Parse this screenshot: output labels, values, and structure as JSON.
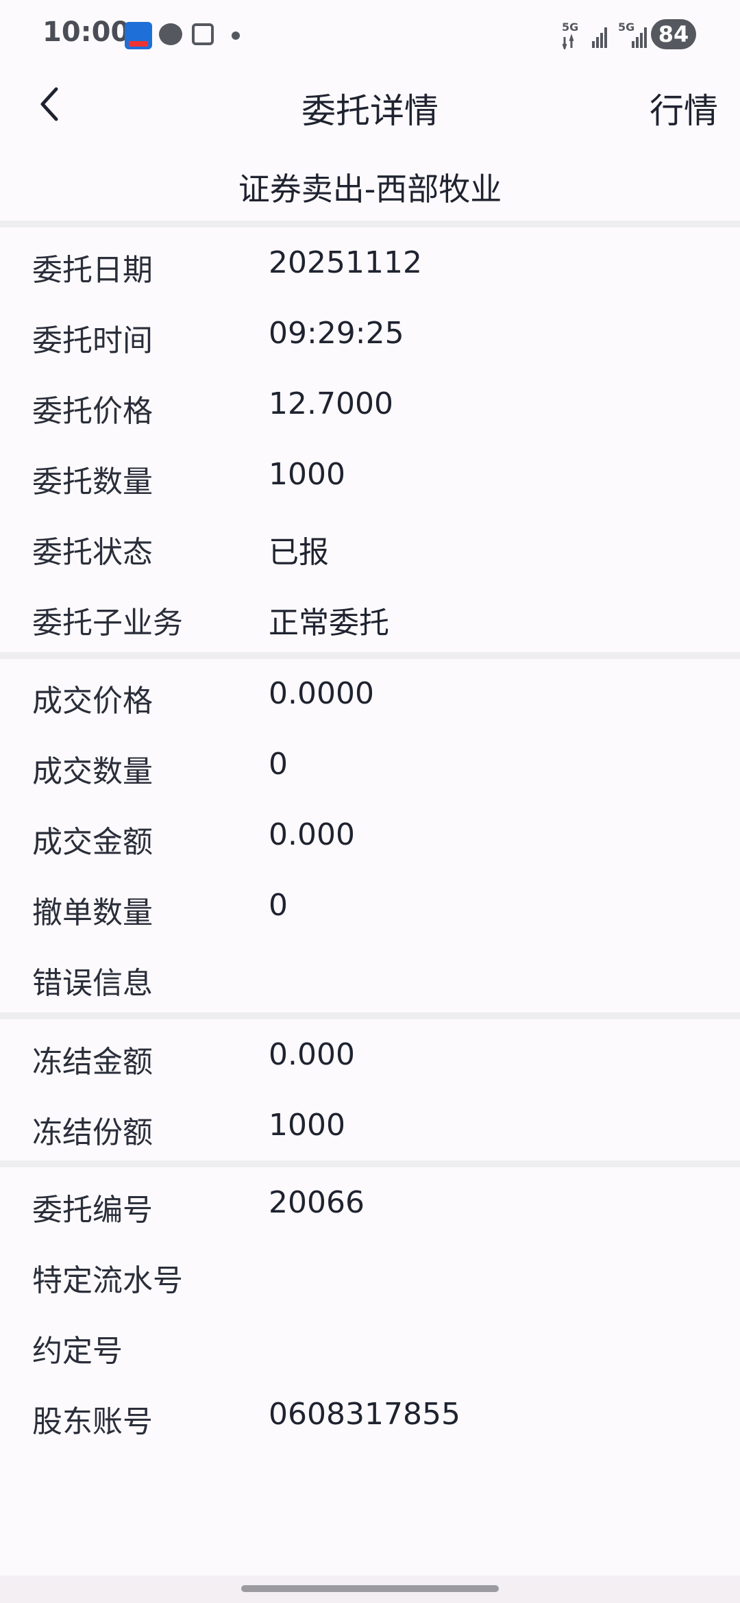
{
  "status_bar": {
    "time": "10:00",
    "battery": "84",
    "network_1": "5G",
    "network_2": "5G"
  },
  "nav": {
    "title": "委托详情",
    "action": "行情",
    "back_icon": "chevron-left-icon"
  },
  "subtitle": "证券卖出-西部牧业",
  "sections": [
    [
      {
        "label": "委托日期",
        "value": "20251112"
      },
      {
        "label": "委托时间",
        "value": "09:29:25"
      },
      {
        "label": "委托价格",
        "value": "12.7000"
      },
      {
        "label": "委托数量",
        "value": "1000"
      },
      {
        "label": "委托状态",
        "value": "已报"
      },
      {
        "label": "委托子业务",
        "value": "正常委托"
      }
    ],
    [
      {
        "label": "成交价格",
        "value": "0.0000"
      },
      {
        "label": "成交数量",
        "value": "0"
      },
      {
        "label": "成交金额",
        "value": "0.000"
      },
      {
        "label": "撤单数量",
        "value": "0"
      },
      {
        "label": "错误信息",
        "value": ""
      }
    ],
    [
      {
        "label": "冻结金额",
        "value": "0.000"
      },
      {
        "label": "冻结份额",
        "value": "1000"
      }
    ],
    [
      {
        "label": "委托编号",
        "value": "20066"
      },
      {
        "label": "特定流水号",
        "value": ""
      },
      {
        "label": "约定号",
        "value": ""
      },
      {
        "label": "股东账号",
        "value": "0608317855"
      }
    ]
  ]
}
